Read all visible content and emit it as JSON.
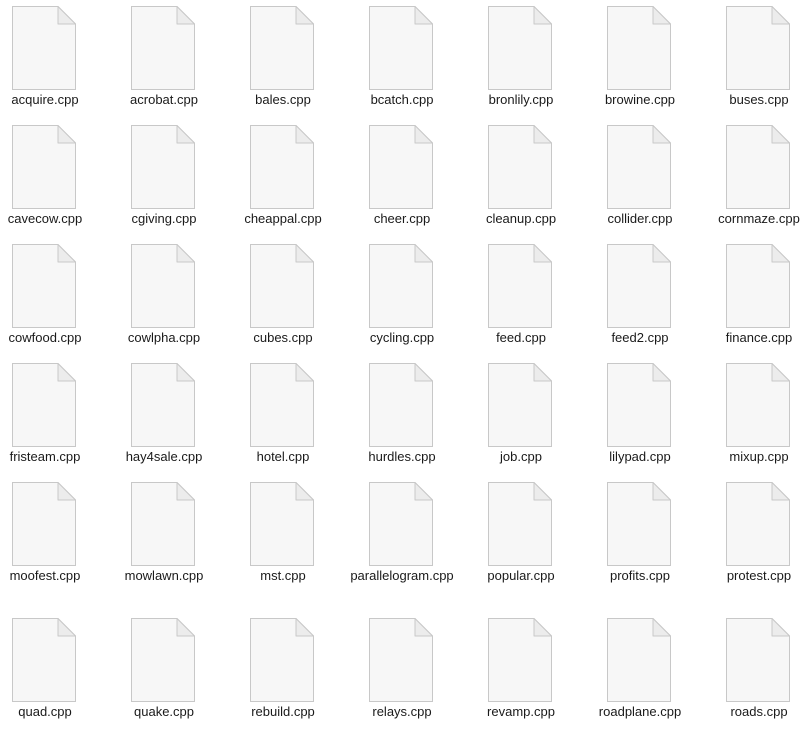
{
  "window": {
    "view": "large-icons"
  },
  "file_icon": {
    "semantic": "blank-document-icon",
    "fill": "#f7f7f7",
    "stroke": "#c8c8c8",
    "fold_fill": "#ececec"
  },
  "files": [
    {
      "name": "acquire.cpp"
    },
    {
      "name": "acrobat.cpp"
    },
    {
      "name": "bales.cpp"
    },
    {
      "name": "bcatch.cpp"
    },
    {
      "name": "bronlily.cpp"
    },
    {
      "name": "browine.cpp"
    },
    {
      "name": "buses.cpp"
    },
    {
      "name": "cavecow.cpp"
    },
    {
      "name": "cgiving.cpp"
    },
    {
      "name": "cheappal.cpp"
    },
    {
      "name": "cheer.cpp"
    },
    {
      "name": "cleanup.cpp"
    },
    {
      "name": "collider.cpp"
    },
    {
      "name": "cornmaze.cpp"
    },
    {
      "name": "cowfood.cpp"
    },
    {
      "name": "cowlpha.cpp"
    },
    {
      "name": "cubes.cpp"
    },
    {
      "name": "cycling.cpp"
    },
    {
      "name": "feed.cpp"
    },
    {
      "name": "feed2.cpp"
    },
    {
      "name": "finance.cpp"
    },
    {
      "name": "fristeam.cpp"
    },
    {
      "name": "hay4sale.cpp"
    },
    {
      "name": "hotel.cpp"
    },
    {
      "name": "hurdles.cpp"
    },
    {
      "name": "job.cpp"
    },
    {
      "name": "lilypad.cpp"
    },
    {
      "name": "mixup.cpp"
    },
    {
      "name": "moofest.cpp"
    },
    {
      "name": "mowlawn.cpp"
    },
    {
      "name": "mst.cpp"
    },
    {
      "name": "parallelogram.cpp"
    },
    {
      "name": "popular.cpp"
    },
    {
      "name": "profits.cpp"
    },
    {
      "name": "protest.cpp"
    },
    {
      "name": "quad.cpp"
    },
    {
      "name": "quake.cpp"
    },
    {
      "name": "rebuild.cpp"
    },
    {
      "name": "relays.cpp"
    },
    {
      "name": "revamp.cpp"
    },
    {
      "name": "roadplane.cpp"
    },
    {
      "name": "roads.cpp"
    }
  ]
}
